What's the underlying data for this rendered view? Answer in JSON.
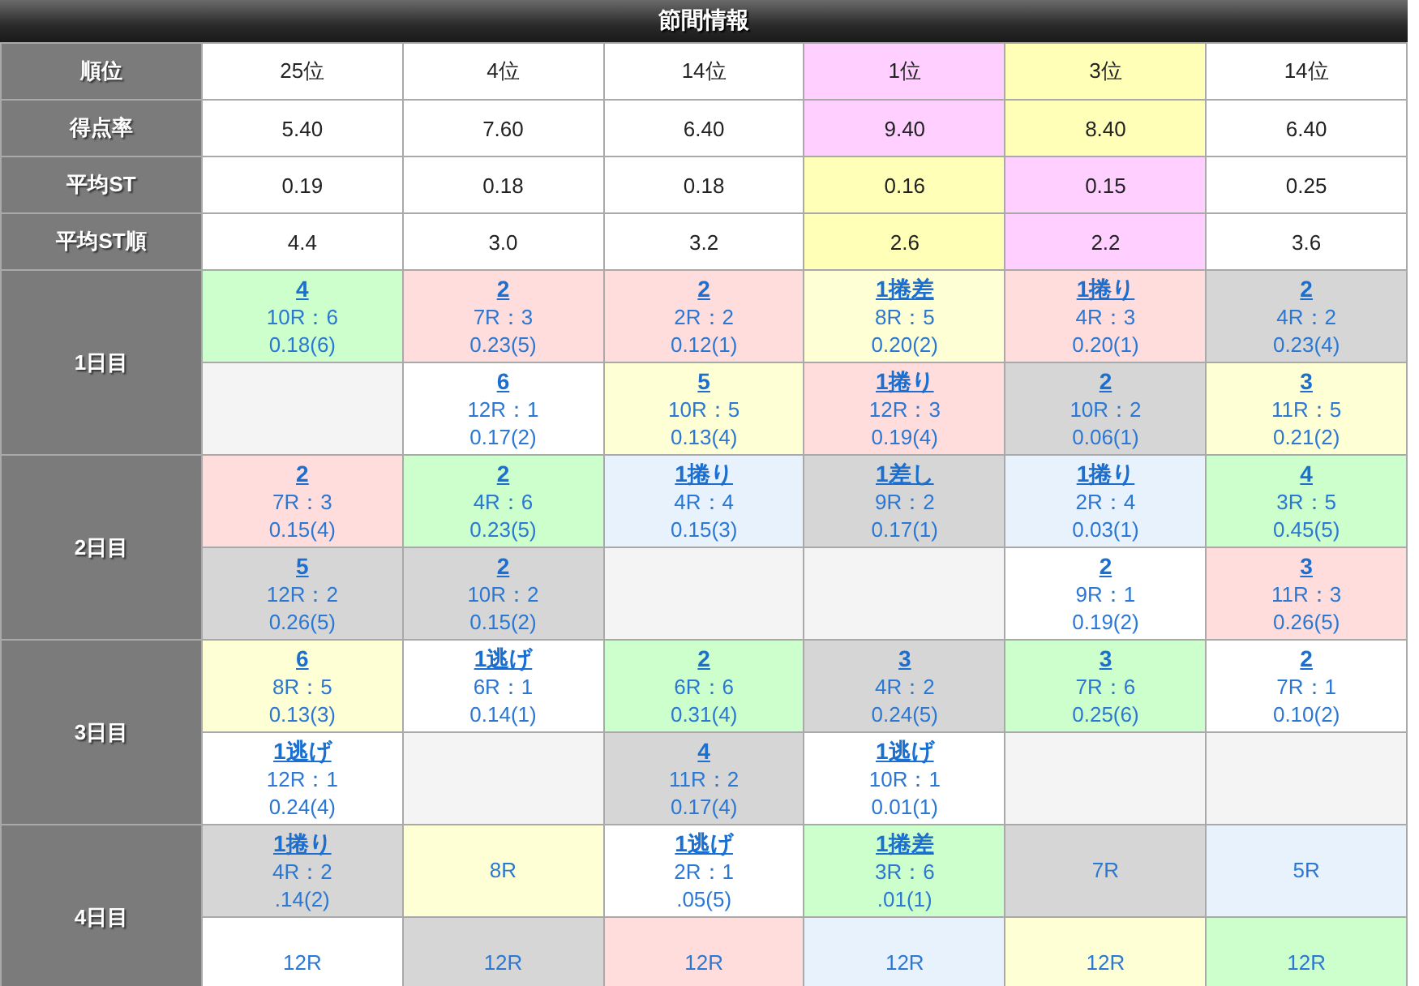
{
  "title": "節間情報",
  "stats": [
    {
      "label": "順位",
      "cells": [
        {
          "text": "25位",
          "color": "#ffffff"
        },
        {
          "text": "4位",
          "color": "#ffffff"
        },
        {
          "text": "14位",
          "color": "#ffffff"
        },
        {
          "text": "1位",
          "color": "#ffd0ff"
        },
        {
          "text": "3位",
          "color": "#ffffb8"
        },
        {
          "text": "14位",
          "color": "#ffffff"
        }
      ]
    },
    {
      "label": "得点率",
      "cells": [
        {
          "text": "5.40",
          "color": "#ffffff"
        },
        {
          "text": "7.60",
          "color": "#ffffff"
        },
        {
          "text": "6.40",
          "color": "#ffffff"
        },
        {
          "text": "9.40",
          "color": "#ffd0ff"
        },
        {
          "text": "8.40",
          "color": "#ffffb8"
        },
        {
          "text": "6.40",
          "color": "#ffffff"
        }
      ]
    },
    {
      "label": "平均ST",
      "cells": [
        {
          "text": "0.19",
          "color": "#ffffff"
        },
        {
          "text": "0.18",
          "color": "#ffffff"
        },
        {
          "text": "0.18",
          "color": "#ffffff"
        },
        {
          "text": "0.16",
          "color": "#ffffb8"
        },
        {
          "text": "0.15",
          "color": "#ffd0ff"
        },
        {
          "text": "0.25",
          "color": "#ffffff"
        }
      ]
    },
    {
      "label": "平均ST順",
      "cells": [
        {
          "text": "4.4",
          "color": "#ffffff"
        },
        {
          "text": "3.0",
          "color": "#ffffff"
        },
        {
          "text": "3.2",
          "color": "#ffffff"
        },
        {
          "text": "2.6",
          "color": "#ffffb8"
        },
        {
          "text": "2.2",
          "color": "#ffd0ff"
        },
        {
          "text": "3.6",
          "color": "#ffffff"
        }
      ]
    }
  ],
  "days": [
    {
      "label": "1日目",
      "slots": [
        [
          {
            "kind": "result",
            "finish": "4",
            "race": "10R：6",
            "st": "0.18(6)",
            "color": "#ccffcc"
          },
          {
            "kind": "result",
            "finish": "2",
            "race": "7R：3",
            "st": "0.23(5)",
            "color": "#ffdddd"
          },
          {
            "kind": "result",
            "finish": "2",
            "race": "2R：2",
            "st": "0.12(1)",
            "color": "#ffdddd"
          },
          {
            "kind": "result",
            "finish": "1捲差",
            "race": "8R：5",
            "st": "0.20(2)",
            "color": "#ffffd5"
          },
          {
            "kind": "result",
            "finish": "1捲り",
            "race": "4R：3",
            "st": "0.20(1)",
            "color": "#ffdddd"
          },
          {
            "kind": "result",
            "finish": "2",
            "race": "4R：2",
            "st": "0.23(4)",
            "color": "#d6d6d6"
          }
        ],
        [
          {
            "kind": "empty",
            "color": "#f4f4f4"
          },
          {
            "kind": "result",
            "finish": "6",
            "race": "12R：1",
            "st": "0.17(2)",
            "color": "#ffffff"
          },
          {
            "kind": "result",
            "finish": "5",
            "race": "10R：5",
            "st": "0.13(4)",
            "color": "#ffffd5"
          },
          {
            "kind": "result",
            "finish": "1捲り",
            "race": "12R：3",
            "st": "0.19(4)",
            "color": "#ffdddd"
          },
          {
            "kind": "result",
            "finish": "2",
            "race": "10R：2",
            "st": "0.06(1)",
            "color": "#d6d6d6"
          },
          {
            "kind": "result",
            "finish": "3",
            "race": "11R：5",
            "st": "0.21(2)",
            "color": "#ffffd5"
          }
        ]
      ]
    },
    {
      "label": "2日目",
      "slots": [
        [
          {
            "kind": "result",
            "finish": "2",
            "race": "7R：3",
            "st": "0.15(4)",
            "color": "#ffdddd"
          },
          {
            "kind": "result",
            "finish": "2",
            "race": "4R：6",
            "st": "0.23(5)",
            "color": "#ccffcc"
          },
          {
            "kind": "result",
            "finish": "1捲り",
            "race": "4R：4",
            "st": "0.15(3)",
            "color": "#e8f2fc"
          },
          {
            "kind": "result",
            "finish": "1差し",
            "race": "9R：2",
            "st": "0.17(1)",
            "color": "#d6d6d6"
          },
          {
            "kind": "result",
            "finish": "1捲り",
            "race": "2R：4",
            "st": "0.03(1)",
            "color": "#e8f2fc"
          },
          {
            "kind": "result",
            "finish": "4",
            "race": "3R：5",
            "st": "0.45(5)",
            "color": "#ccffcc"
          }
        ],
        [
          {
            "kind": "result",
            "finish": "5",
            "race": "12R：2",
            "st": "0.26(5)",
            "color": "#d6d6d6"
          },
          {
            "kind": "result",
            "finish": "2",
            "race": "10R：2",
            "st": "0.15(2)",
            "color": "#d6d6d6"
          },
          {
            "kind": "empty",
            "color": "#f4f4f4"
          },
          {
            "kind": "empty",
            "color": "#f4f4f4"
          },
          {
            "kind": "result",
            "finish": "2",
            "race": "9R：1",
            "st": "0.19(2)",
            "color": "#ffffff"
          },
          {
            "kind": "result",
            "finish": "3",
            "race": "11R：3",
            "st": "0.26(5)",
            "color": "#ffdddd"
          }
        ]
      ]
    },
    {
      "label": "3日目",
      "slots": [
        [
          {
            "kind": "result",
            "finish": "6",
            "race": "8R：5",
            "st": "0.13(3)",
            "color": "#ffffd5"
          },
          {
            "kind": "result",
            "finish": "1逃げ",
            "race": "6R：1",
            "st": "0.14(1)",
            "color": "#ffffff"
          },
          {
            "kind": "result",
            "finish": "2",
            "race": "6R：6",
            "st": "0.31(4)",
            "color": "#ccffcc"
          },
          {
            "kind": "result",
            "finish": "3",
            "race": "4R：2",
            "st": "0.24(5)",
            "color": "#d6d6d6"
          },
          {
            "kind": "result",
            "finish": "3",
            "race": "7R：6",
            "st": "0.25(6)",
            "color": "#ccffcc"
          },
          {
            "kind": "result",
            "finish": "2",
            "race": "7R：1",
            "st": "0.10(2)",
            "color": "#ffffff"
          }
        ],
        [
          {
            "kind": "result",
            "finish": "1逃げ",
            "race": "12R：1",
            "st": "0.24(4)",
            "color": "#ffffff"
          },
          {
            "kind": "empty",
            "color": "#f4f4f4"
          },
          {
            "kind": "result",
            "finish": "4",
            "race": "11R：2",
            "st": "0.17(4)",
            "color": "#d6d6d6"
          },
          {
            "kind": "result",
            "finish": "1逃げ",
            "race": "10R：1",
            "st": "0.01(1)",
            "color": "#ffffff"
          },
          {
            "kind": "empty",
            "color": "#f4f4f4"
          },
          {
            "kind": "empty",
            "color": "#f4f4f4"
          }
        ]
      ]
    },
    {
      "label": "4日目",
      "slots": [
        [
          {
            "kind": "result",
            "finish": "1捲り",
            "race": "4R：2",
            "st": ".14(2)",
            "color": "#d6d6d6"
          },
          {
            "kind": "race",
            "race": "8R",
            "color": "#ffffd5"
          },
          {
            "kind": "result",
            "finish": "1逃げ",
            "race": "2R：1",
            "st": ".05(5)",
            "color": "#ffffff"
          },
          {
            "kind": "result",
            "finish": "1捲差",
            "race": "3R：6",
            "st": ".01(1)",
            "color": "#ccffcc"
          },
          {
            "kind": "race",
            "race": "7R",
            "color": "#d6d6d6"
          },
          {
            "kind": "race",
            "race": "5R",
            "color": "#e8f2fc"
          }
        ],
        [
          {
            "kind": "race",
            "race": "12R",
            "color": "#ffffff"
          },
          {
            "kind": "race",
            "race": "12R",
            "color": "#d6d6d6"
          },
          {
            "kind": "race",
            "race": "12R",
            "color": "#ffdddd"
          },
          {
            "kind": "race",
            "race": "12R",
            "color": "#e8f2fc"
          },
          {
            "kind": "race",
            "race": "12R",
            "color": "#ffffd5"
          },
          {
            "kind": "race",
            "race": "12R",
            "color": "#ccffcc"
          }
        ]
      ]
    }
  ]
}
